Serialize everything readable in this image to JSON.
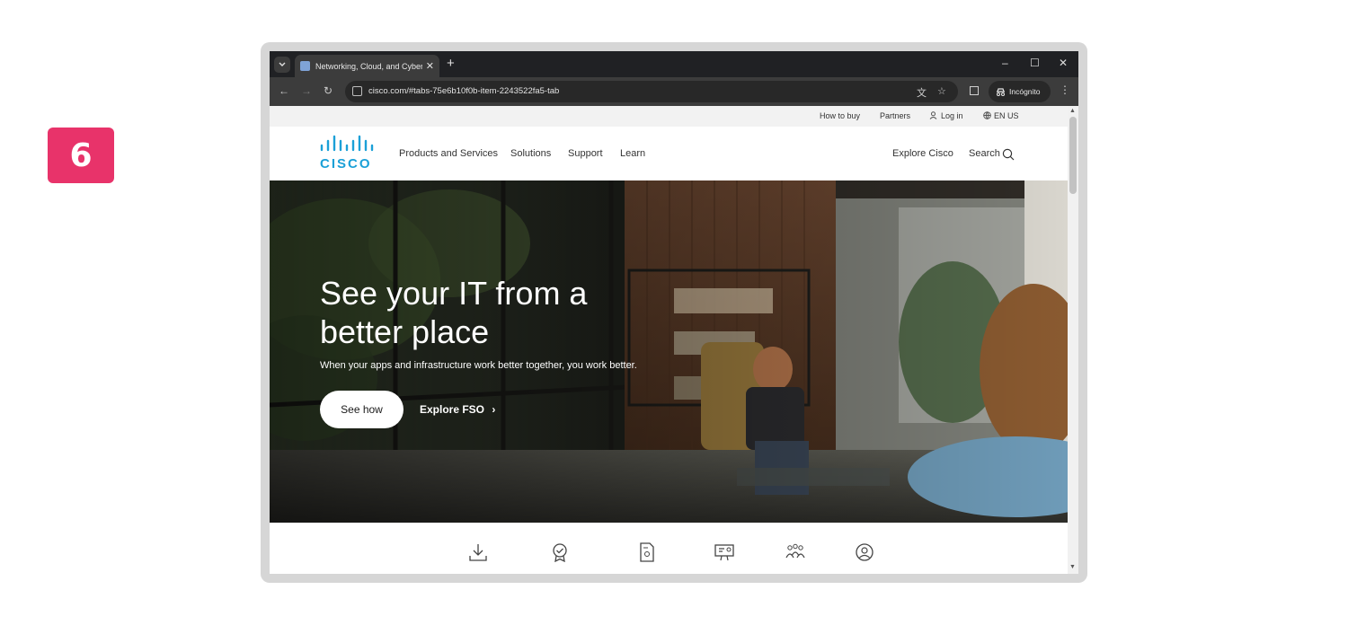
{
  "step_number": "6",
  "browser": {
    "tab_title": "Networking, Cloud, and Cybersecurity",
    "new_tab_label": "+",
    "url": "cisco.com/#tabs-75e6b10f0b-item-2243522fa5-tab",
    "incognito_label": "Incógnito",
    "window_controls": {
      "minimize": "–",
      "maximize": "☐",
      "close": "✕"
    },
    "nav": {
      "back": "←",
      "forward": "→",
      "reload": "↻"
    }
  },
  "site": {
    "utility_links": {
      "how_to_buy": "How to buy",
      "partners": "Partners",
      "log_in": "Log in",
      "language": "EN US"
    },
    "logo_text": "CISCO",
    "nav": {
      "items": [
        {
          "label": "Products and Services"
        },
        {
          "label": "Solutions"
        },
        {
          "label": "Support"
        },
        {
          "label": "Learn"
        }
      ],
      "explore": "Explore Cisco",
      "search": "Search"
    },
    "hero": {
      "headline": "See your IT from a better place",
      "subhead": "When your apps and infrastructure work better together, you work better.",
      "primary_cta": "See how",
      "secondary_cta": "Explore FSO"
    },
    "quick_links": [
      {
        "icon": "download-icon"
      },
      {
        "icon": "certification-icon"
      },
      {
        "icon": "document-icon"
      },
      {
        "icon": "training-icon"
      },
      {
        "icon": "community-icon"
      },
      {
        "icon": "account-icon"
      }
    ]
  },
  "colors": {
    "badge": "#e8336a",
    "cisco_blue": "#1ba0d7",
    "browser_dark": "#202124"
  }
}
